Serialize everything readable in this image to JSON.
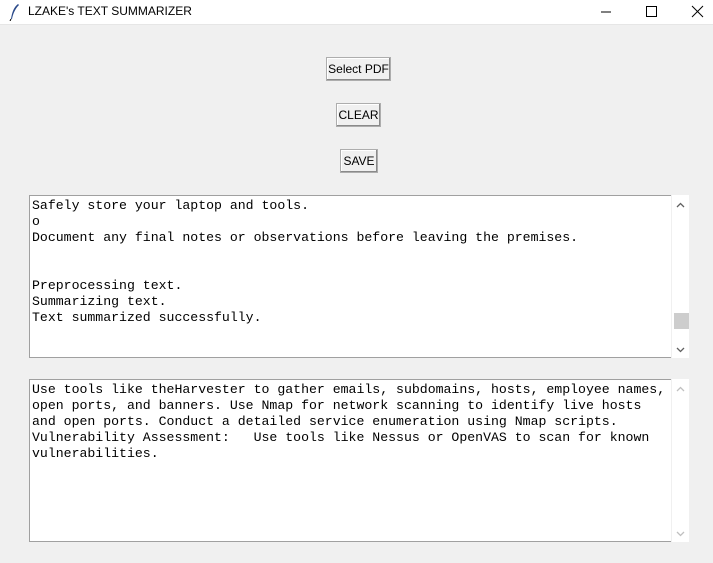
{
  "window": {
    "title": "LZAKE's TEXT SUMMARIZER",
    "icon": "feather-icon"
  },
  "buttons": {
    "select_pdf": "Select PDF",
    "clear": "CLEAR",
    "save": "SAVE"
  },
  "log_box": {
    "lines": [
      "Safely store your laptop and tools.",
      "o",
      "Document any final notes or observations before leaving the premises.",
      "",
      "",
      "Preprocessing text.",
      "Summarizing text.",
      "Text summarized successfully."
    ],
    "scroll_position": 0.9
  },
  "summary_box": {
    "lines": [
      "Use tools like theHarvester to gather emails, subdomains, hosts, employee names,",
      "open ports, and banners. Use Nmap for network scanning to identify live hosts",
      "and open ports. Conduct a detailed service enumeration using Nmap scripts.",
      "Vulnerability Assessment:   Use tools like Nessus or OpenVAS to scan for known",
      "vulnerabilities."
    ]
  }
}
